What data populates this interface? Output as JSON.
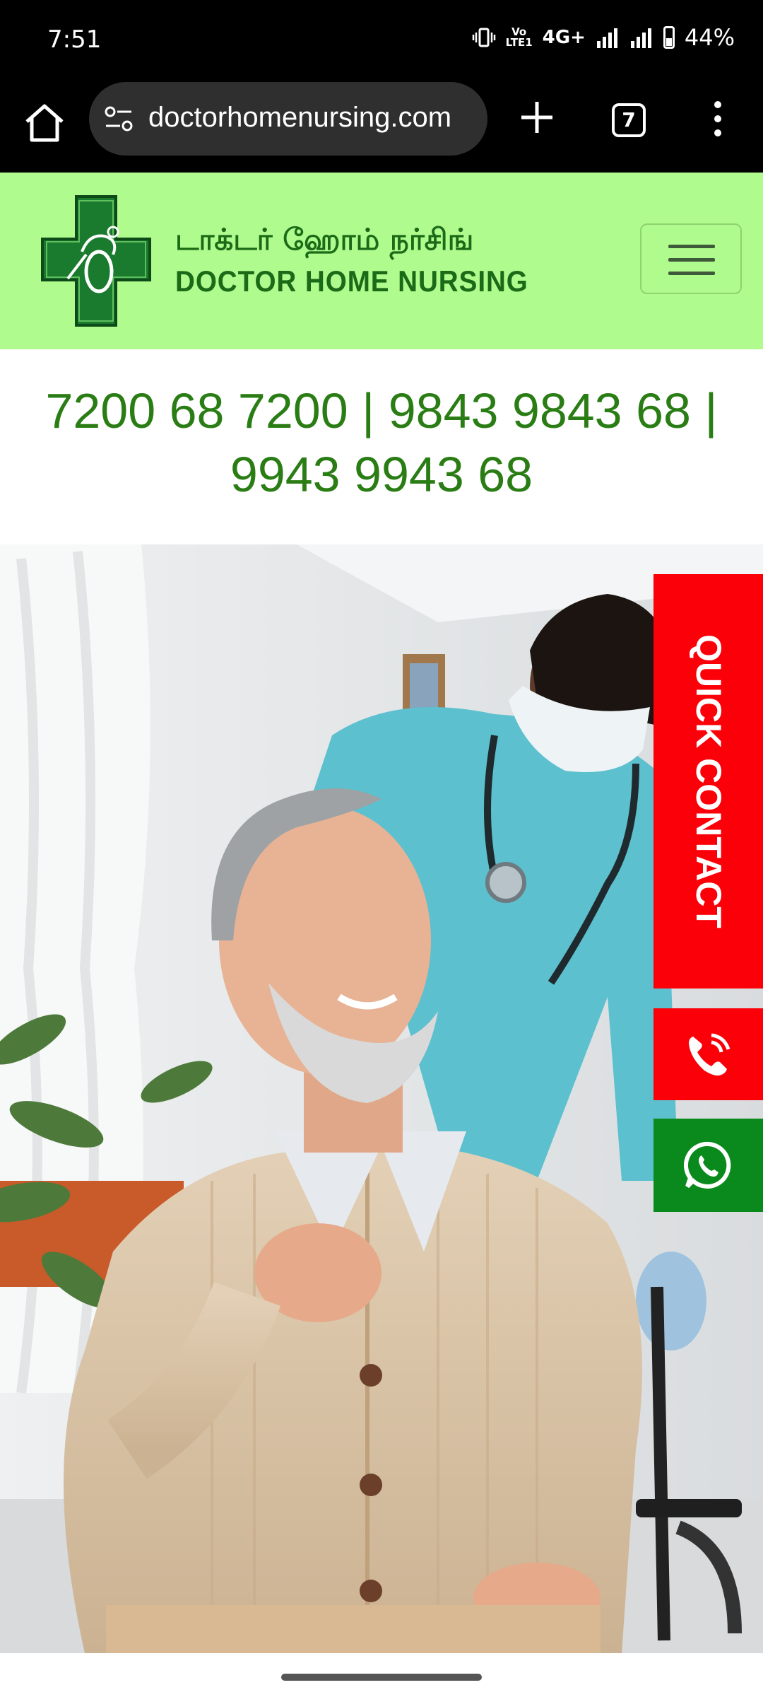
{
  "status_bar": {
    "time": "7:51",
    "volte": "Vo\nLTE1",
    "network": "4G+",
    "battery": "44%"
  },
  "browser": {
    "url": "doctorhomenursing.com",
    "tab_count": "7",
    "icons": {
      "home": "home-icon",
      "site_settings": "tune-icon",
      "new_tab": "plus-icon",
      "tabs": "tab-switcher-icon",
      "menu": "kebab-menu-icon"
    }
  },
  "site": {
    "brand_tamil": "டாக்டர் ஹோம் நர்சிங்",
    "brand_english": "DOCTOR HOME NURSING",
    "header_bg": "#b0fb8e",
    "brand_color": "#1b6a17",
    "phones": "7200 68 7200 | 9843 9843 68 | 9943 9943 68",
    "phone_color": "#2a7d14"
  },
  "side_actions": {
    "quick_contact": "QUICK CONTACT",
    "quick_contact_bg": "#fb0008",
    "call_icon": "phone-call-icon",
    "whatsapp_icon": "whatsapp-icon",
    "whatsapp_bg": "#0a8a1c"
  }
}
